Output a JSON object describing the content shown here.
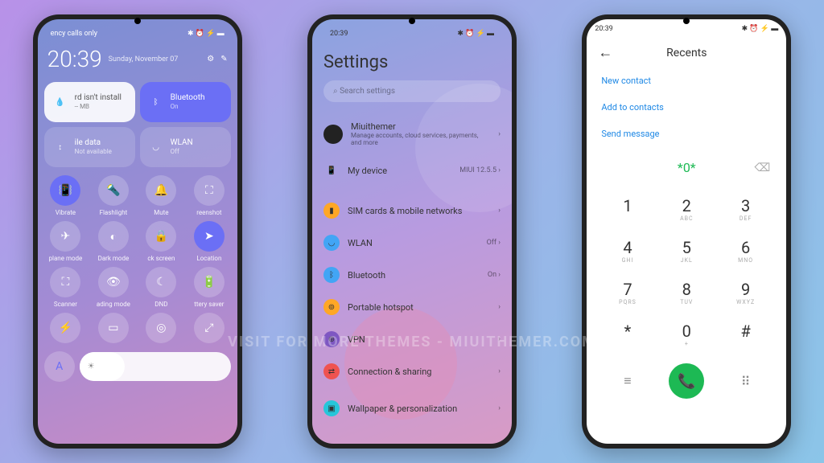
{
  "status": {
    "time": "20:39",
    "carrier": "ency calls only"
  },
  "cc": {
    "date": "Sunday, November\n07",
    "tiles": {
      "card": {
        "label": "rd isn't install",
        "sub": "-- MB"
      },
      "bluetooth": {
        "label": "Bluetooth",
        "sub": "On"
      },
      "data": {
        "label": "ile data",
        "sub": "Not available"
      },
      "wlan": {
        "label": "WLAN",
        "sub": "Off"
      }
    },
    "qs": [
      "Vibrate",
      "Flashlight",
      "Mute",
      "reenshot",
      "plane mode",
      "Dark mode",
      "ck screen",
      "Location",
      "Scanner",
      "ading mode",
      "DND",
      "ttery saver"
    ]
  },
  "settings": {
    "title": "Settings",
    "search": "Search settings",
    "account": {
      "name": "Miuithemer",
      "sub": "Manage accounts, cloud services, payments, and more"
    },
    "device": {
      "label": "My device",
      "right": "MIUI 12.5.5"
    },
    "items": [
      {
        "label": "SIM cards & mobile networks",
        "right": ""
      },
      {
        "label": "WLAN",
        "right": "Off"
      },
      {
        "label": "Bluetooth",
        "right": "On"
      },
      {
        "label": "Portable hotspot",
        "right": ""
      },
      {
        "label": "VPN",
        "right": ""
      },
      {
        "label": "Connection & sharing",
        "right": ""
      },
      {
        "label": "Wallpaper & personalization",
        "right": ""
      }
    ]
  },
  "dialer": {
    "title": "Recents",
    "options": [
      "New contact",
      "Add to contacts",
      "Send message"
    ],
    "number": "*0*",
    "keys": [
      {
        "n": "1",
        "s": ""
      },
      {
        "n": "2",
        "s": "ABC"
      },
      {
        "n": "3",
        "s": "DEF"
      },
      {
        "n": "4",
        "s": "GHI"
      },
      {
        "n": "5",
        "s": "JKL"
      },
      {
        "n": "6",
        "s": "MNO"
      },
      {
        "n": "7",
        "s": "PQRS"
      },
      {
        "n": "8",
        "s": "TUV"
      },
      {
        "n": "9",
        "s": "WXYZ"
      },
      {
        "n": "*",
        "s": ""
      },
      {
        "n": "0",
        "s": "+"
      },
      {
        "n": "#",
        "s": ""
      }
    ]
  },
  "watermark": "VISIT FOR MORE THEMES - MIUITHEMER.COM"
}
